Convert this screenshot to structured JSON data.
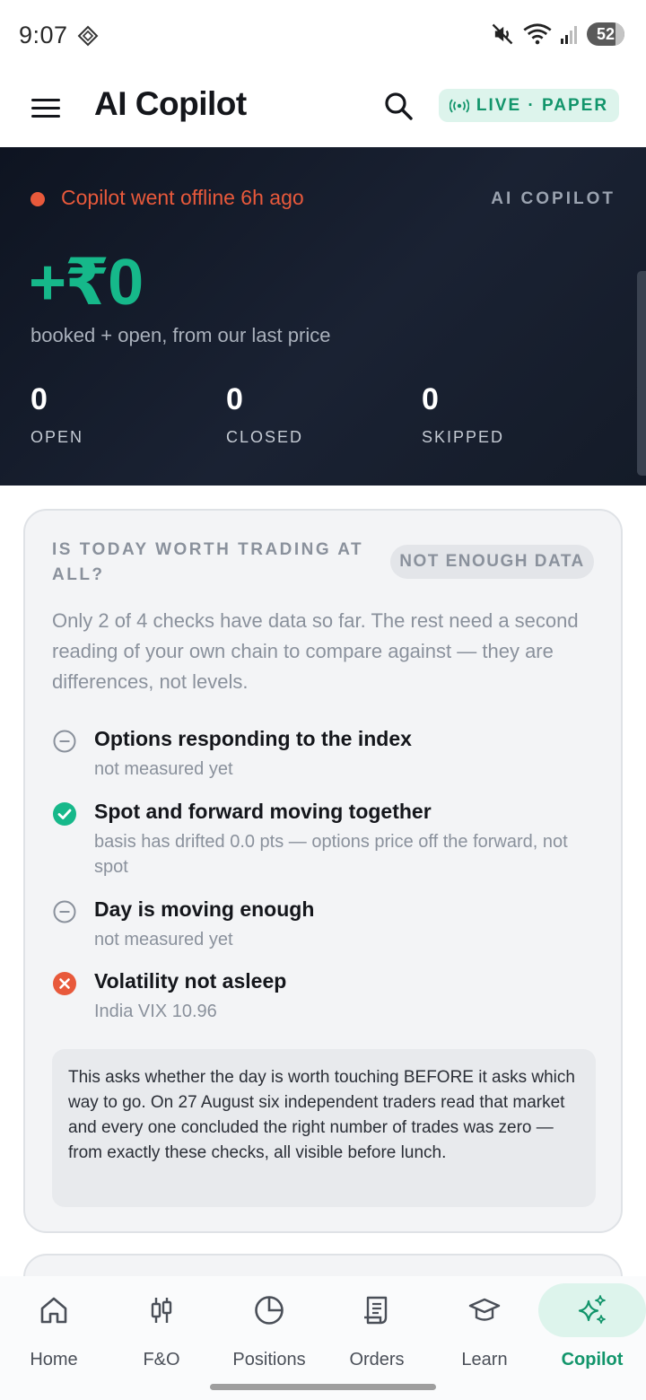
{
  "status_bar": {
    "time": "9:07",
    "battery": "52",
    "icons": [
      "diamond-icon",
      "mute-icon",
      "wifi-icon",
      "signal-icon",
      "battery-icon"
    ]
  },
  "app_bar": {
    "title": "AI Copilot",
    "mode_pill": "LIVE · PAPER"
  },
  "hero": {
    "offline_text": "Copilot went offline 6h ago",
    "tag": "AI COPILOT",
    "pnl": "+₹0",
    "pnl_sub": "booked + open, from our last price",
    "stats": [
      {
        "value": "0",
        "label": "OPEN"
      },
      {
        "value": "0",
        "label": "CLOSED"
      },
      {
        "value": "0",
        "label": "SKIPPED"
      }
    ],
    "colors": {
      "offline": "#e8593b",
      "pnl": "#16b88a"
    }
  },
  "card": {
    "heading": "IS TODAY WORTH TRADING AT ALL?",
    "badge": "NOT ENOUGH DATA",
    "description": "Only 2 of 4 checks have data so far. The rest need a second reading of your own chain to compare against — they are differences, not levels.",
    "checks": [
      {
        "status": "pending",
        "icon": "minus-circle-icon",
        "title": "Options responding to the index",
        "sub": "not measured yet"
      },
      {
        "status": "pass",
        "icon": "check-circle-icon",
        "title": "Spot and forward moving together",
        "sub": "basis has drifted 0.0 pts — options price off the forward, not spot"
      },
      {
        "status": "pending",
        "icon": "minus-circle-icon",
        "title": "Day is moving enough",
        "sub": "not measured yet"
      },
      {
        "status": "fail",
        "icon": "x-circle-icon",
        "title": "Volatility not asleep",
        "sub": "India VIX 10.96"
      }
    ],
    "note": "This asks whether the day is worth touching BEFORE it asks which way to go. On 27 August six independent traders read that market and every one concluded the right number of trades was zero — from exactly these checks, all visible before lunch."
  },
  "bottom_nav": {
    "items": [
      {
        "label": "Home",
        "icon": "home-icon"
      },
      {
        "label": "F&O",
        "icon": "candlestick-icon"
      },
      {
        "label": "Positions",
        "icon": "pie-chart-icon"
      },
      {
        "label": "Orders",
        "icon": "receipt-icon"
      },
      {
        "label": "Learn",
        "icon": "graduation-cap-icon"
      },
      {
        "label": "Copilot",
        "icon": "sparkles-icon",
        "active": true
      }
    ],
    "active_color": "#12956b"
  }
}
